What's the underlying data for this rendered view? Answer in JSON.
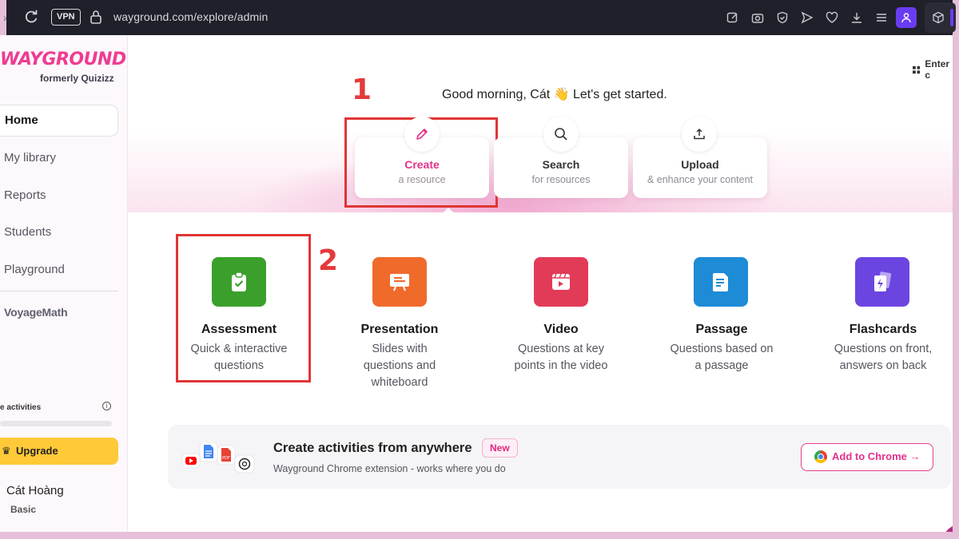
{
  "browser": {
    "vpn_label": "VPN",
    "url": "wayground.com/explore/admin"
  },
  "sidebar": {
    "logo": "WAYGROUND",
    "logo_sub": "formerly Quizizz",
    "nav": [
      "Home",
      "My library",
      "Reports",
      "Students",
      "Playground"
    ],
    "voyage": "VoyageMath",
    "activities_label": "e activities",
    "activities_progress": 0,
    "upgrade_label": "Upgrade",
    "user_name": "Cát Hoàng",
    "user_plan": "Basic"
  },
  "header": {
    "enter_code": "Enter c",
    "greeting": "Good morning, Cát 👋 Let's get started."
  },
  "actions": [
    {
      "title": "Create",
      "subtitle": "a resource",
      "icon": "pencil-icon",
      "active": true
    },
    {
      "title": "Search",
      "subtitle": "for resources",
      "icon": "search-icon",
      "active": false
    },
    {
      "title": "Upload",
      "subtitle": "& enhance your content",
      "icon": "upload-icon",
      "active": false
    }
  ],
  "annotations": [
    "1",
    "2"
  ],
  "types": [
    {
      "title": "Assessment",
      "desc": [
        "Quick & interactive",
        "questions"
      ],
      "color": "#3aa02b",
      "icon": "clipboard-check-icon"
    },
    {
      "title": "Presentation",
      "desc": [
        "Slides with",
        "questions and",
        "whiteboard"
      ],
      "color": "#f06a2c",
      "icon": "presentation-icon"
    },
    {
      "title": "Video",
      "desc": [
        "Questions at key",
        "points in the video"
      ],
      "color": "#e23b57",
      "icon": "video-icon"
    },
    {
      "title": "Passage",
      "desc": [
        "Questions based on",
        "a passage"
      ],
      "color": "#1e8bd6",
      "icon": "passage-icon"
    },
    {
      "title": "Flashcards",
      "desc": [
        "Questions on front,",
        "answers on back"
      ],
      "color": "#6b45e0",
      "icon": "flashcards-icon"
    }
  ],
  "banner": {
    "title": "Create activities from anywhere",
    "badge": "New",
    "subtitle": "Wayground Chrome extension - works where you do",
    "button": "Add to Chrome →"
  },
  "colors": {
    "brand_pink": "#e3318b",
    "annotation_red": "#e03535",
    "upgrade_yellow": "#ffc938"
  }
}
